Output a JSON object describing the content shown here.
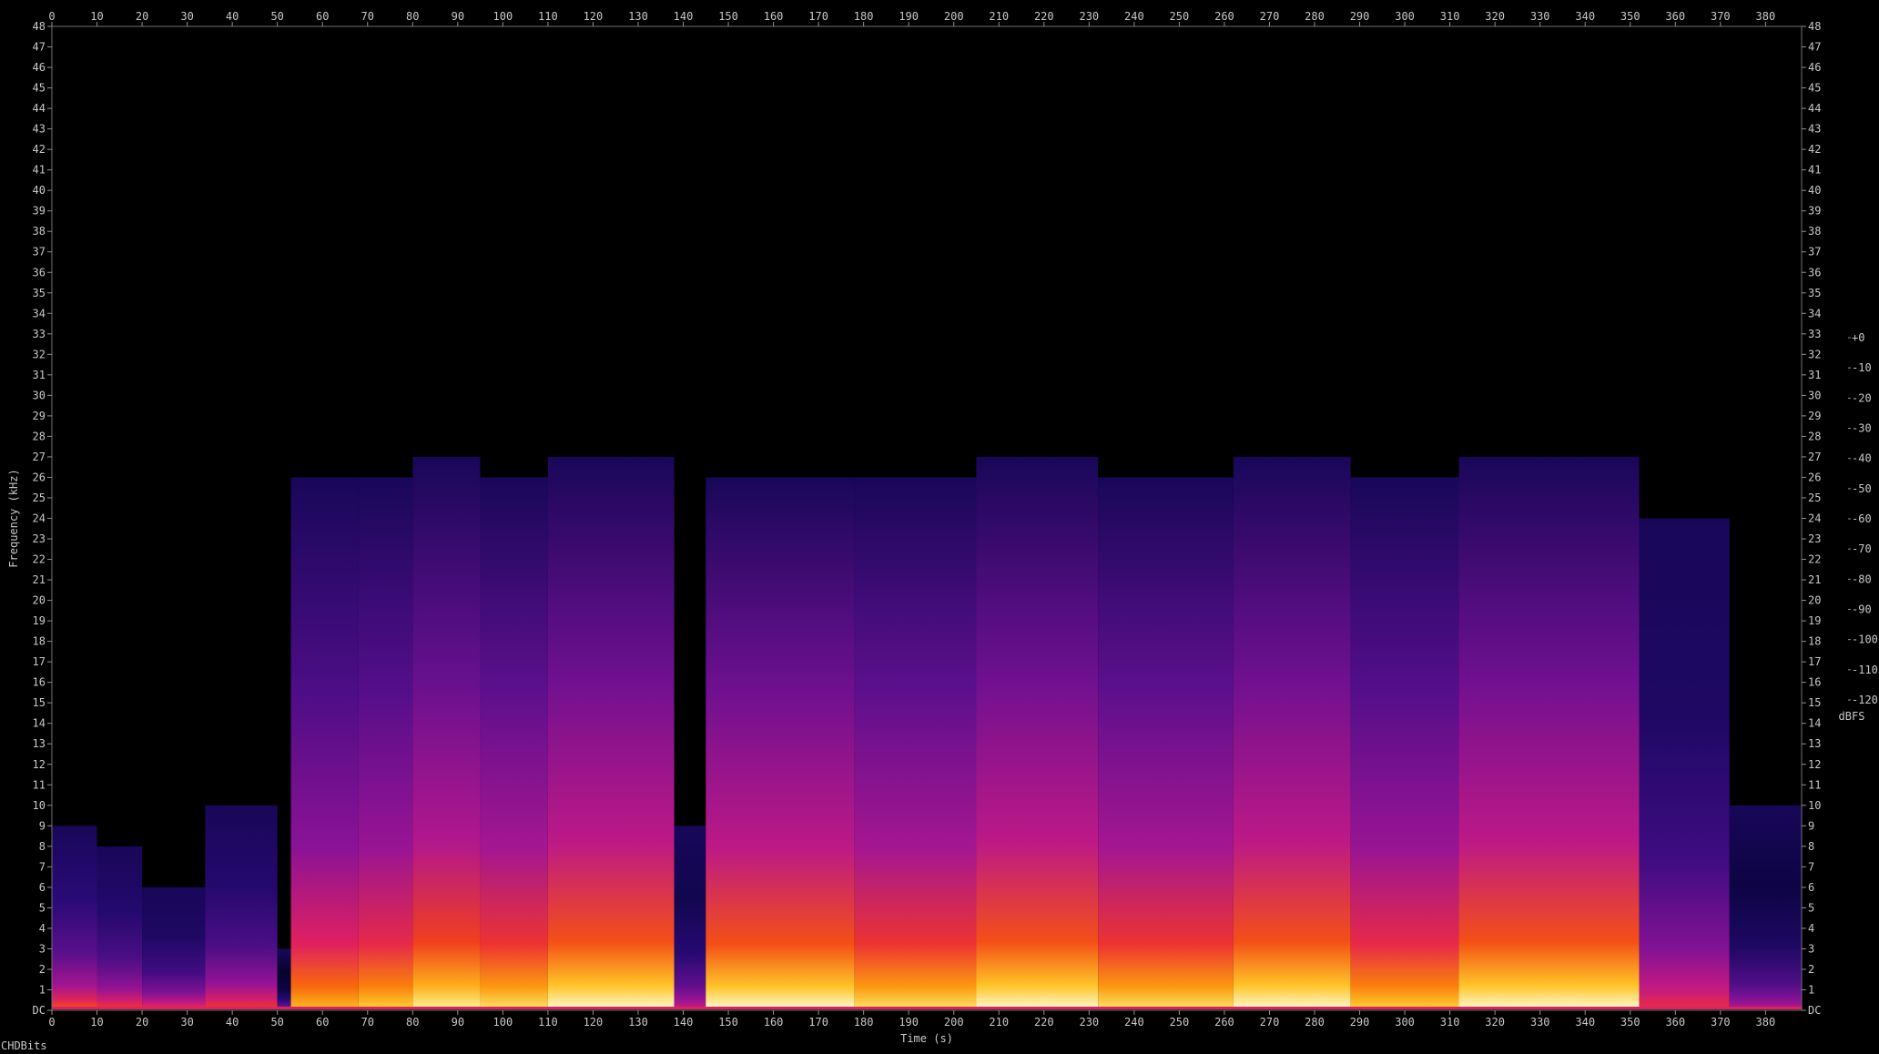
{
  "footer": {
    "label": "CHDBits"
  },
  "chart_data": {
    "type": "heatmap",
    "title": "",
    "xlabel": "Time (s)",
    "ylabel": "Frequency (kHz)",
    "xlim": [
      0,
      388
    ],
    "ylim": [
      0,
      48
    ],
    "x_ticks": [
      0,
      10,
      20,
      30,
      40,
      50,
      60,
      70,
      80,
      90,
      100,
      110,
      120,
      130,
      140,
      150,
      160,
      170,
      180,
      190,
      200,
      210,
      220,
      230,
      240,
      250,
      260,
      270,
      280,
      290,
      300,
      310,
      320,
      330,
      340,
      350,
      360,
      370,
      380
    ],
    "y_ticks": [
      "DC",
      "1",
      "2",
      "3",
      "4",
      "5",
      "6",
      "7",
      "8",
      "9",
      "10",
      "11",
      "12",
      "13",
      "14",
      "15",
      "16",
      "17",
      "18",
      "19",
      "20",
      "21",
      "22",
      "23",
      "24",
      "25",
      "26",
      "27",
      "28",
      "29",
      "30",
      "31",
      "32",
      "33",
      "34",
      "35",
      "36",
      "37",
      "38",
      "39",
      "40",
      "41",
      "42",
      "43",
      "44",
      "45",
      "46",
      "47",
      "48"
    ],
    "colorbar": {
      "label": "dBFS",
      "range": [
        -120,
        0
      ],
      "ticks": [
        "+0",
        "-10",
        "-20",
        "-30",
        "-40",
        "-50",
        "-60",
        "-70",
        "-80",
        "-90",
        "-100",
        "-110",
        "-120"
      ],
      "colors": [
        "#000000",
        "#0a0440",
        "#2a0a78",
        "#5a0f8c",
        "#8a1296",
        "#b8188c",
        "#e02060",
        "#f03a20",
        "#f86a0a",
        "#fda010",
        "#fed030",
        "#fff090",
        "#ffffff"
      ]
    },
    "energy_segments": [
      {
        "t0": 0,
        "t1": 10,
        "fmax": 9,
        "loud": 0.55
      },
      {
        "t0": 10,
        "t1": 20,
        "fmax": 8,
        "loud": 0.5
      },
      {
        "t0": 20,
        "t1": 34,
        "fmax": 6,
        "loud": 0.45
      },
      {
        "t0": 34,
        "t1": 50,
        "fmax": 10,
        "loud": 0.5
      },
      {
        "t0": 50,
        "t1": 53,
        "fmax": 3,
        "loud": 0.2
      },
      {
        "t0": 53,
        "t1": 68,
        "fmax": 26,
        "loud": 0.75
      },
      {
        "t0": 68,
        "t1": 80,
        "fmax": 26,
        "loud": 0.8
      },
      {
        "t0": 80,
        "t1": 95,
        "fmax": 27,
        "loud": 0.9
      },
      {
        "t0": 95,
        "t1": 110,
        "fmax": 26,
        "loud": 0.85
      },
      {
        "t0": 110,
        "t1": 138,
        "fmax": 27,
        "loud": 0.95
      },
      {
        "t0": 138,
        "t1": 145,
        "fmax": 9,
        "loud": 0.35
      },
      {
        "t0": 145,
        "t1": 178,
        "fmax": 26,
        "loud": 0.95
      },
      {
        "t0": 178,
        "t1": 205,
        "fmax": 26,
        "loud": 0.85
      },
      {
        "t0": 205,
        "t1": 232,
        "fmax": 27,
        "loud": 0.95
      },
      {
        "t0": 232,
        "t1": 262,
        "fmax": 26,
        "loud": 0.85
      },
      {
        "t0": 262,
        "t1": 288,
        "fmax": 27,
        "loud": 0.95
      },
      {
        "t0": 288,
        "t1": 312,
        "fmax": 26,
        "loud": 0.8
      },
      {
        "t0": 312,
        "t1": 352,
        "fmax": 27,
        "loud": 0.95
      },
      {
        "t0": 352,
        "t1": 372,
        "fmax": 24,
        "loud": 0.45
      },
      {
        "t0": 372,
        "t1": 388,
        "fmax": 10,
        "loud": 0.3
      }
    ]
  }
}
